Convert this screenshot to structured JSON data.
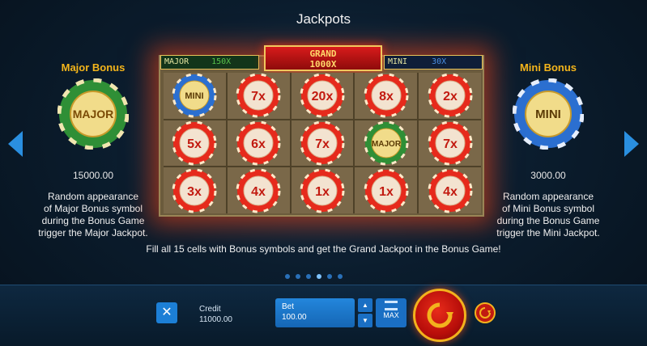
{
  "page": {
    "title": "Jackpots"
  },
  "colors": {
    "accent_blue": "#2a8fe0",
    "gold": "#f4b51b",
    "major_green": "#2f8f36",
    "mini_blue": "#2b6fd0",
    "red_chip": "#e62a1c"
  },
  "major_bonus": {
    "title": "Major Bonus",
    "chip_label": "MAJOR",
    "value": "15000.00",
    "desc_lines": [
      "Random appearance",
      "of Major Bonus symbol",
      "during the Bonus Game",
      "trigger the Major Jackpot."
    ]
  },
  "mini_bonus": {
    "title": "Mini Bonus",
    "chip_label": "MINI",
    "value": "3000.00",
    "desc_lines": [
      "Random appearance",
      "of Mini Bonus symbol",
      "during the Bonus Game",
      "trigger the Mini Jackpot."
    ]
  },
  "board": {
    "major_label": "MAJOR",
    "major_mult": "150X",
    "grand_label": "GRAND",
    "grand_mult": "1000X",
    "mini_label": "MINI",
    "mini_mult": "30X",
    "cells": [
      {
        "type": "mini",
        "label": "MINI"
      },
      {
        "type": "red",
        "label": "7x"
      },
      {
        "type": "red",
        "label": "20x"
      },
      {
        "type": "red",
        "label": "8x"
      },
      {
        "type": "red",
        "label": "2x"
      },
      {
        "type": "red",
        "label": "5x"
      },
      {
        "type": "red",
        "label": "6x"
      },
      {
        "type": "red",
        "label": "7x"
      },
      {
        "type": "major",
        "label": "MAJOR"
      },
      {
        "type": "red",
        "label": "7x"
      },
      {
        "type": "red",
        "label": "3x"
      },
      {
        "type": "red",
        "label": "4x"
      },
      {
        "type": "red",
        "label": "1x"
      },
      {
        "type": "red",
        "label": "1x"
      },
      {
        "type": "red",
        "label": "4x"
      }
    ]
  },
  "hint": "Fill all 15 cells with Bonus symbols and get the Grand Jackpot in the Bonus Game!",
  "pagination": {
    "count": 6,
    "active": 3
  },
  "controls": {
    "close_symbol": "✕",
    "credit_label": "Credit",
    "credit_value": "11000.00",
    "bet_label": "Bet",
    "bet_value": "100.00",
    "bet_up_symbol": "▲",
    "bet_down_symbol": "▼",
    "max_label": "MAX"
  }
}
